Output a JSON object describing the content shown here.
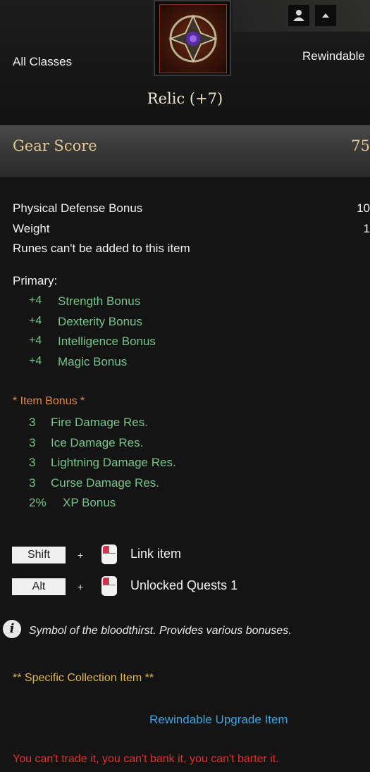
{
  "header": {
    "class_label": "All Classes",
    "rewindable_label": "Rewindable",
    "item_title": "Relic (+7)"
  },
  "gear": {
    "label": "Gear Score",
    "value": "75"
  },
  "stats": [
    {
      "label": "Physical Defense Bonus",
      "value": "10"
    },
    {
      "label": "Weight",
      "value": "1"
    },
    {
      "label": "Runes can't be added to this item",
      "value": ""
    }
  ],
  "primary": {
    "heading": "Primary:",
    "items": [
      {
        "value": "+4",
        "name": "Strength Bonus"
      },
      {
        "value": "+4",
        "name": "Dexterity Bonus"
      },
      {
        "value": "+4",
        "name": "Intelligence Bonus"
      },
      {
        "value": "+4",
        "name": "Magic Bonus"
      }
    ]
  },
  "item_bonus": {
    "heading": "* Item Bonus *",
    "items": [
      {
        "value": "3",
        "name": "Fire Damage Res."
      },
      {
        "value": "3",
        "name": "Ice Damage Res."
      },
      {
        "value": "3",
        "name": "Lightning Damage Res."
      },
      {
        "value": "3",
        "name": "Curse Damage Res."
      },
      {
        "value": "2%",
        "name": "XP Bonus"
      }
    ]
  },
  "actions": [
    {
      "key": "Shift",
      "plus": "+",
      "label": "Link item"
    },
    {
      "key": "Alt",
      "plus": "+",
      "label": "Unlocked Quests 1"
    }
  ],
  "description": "Symbol of the bloodthirst. Provides various bonuses.",
  "collection": "** Specific Collection Item **",
  "upgrade": "Rewindable Upgrade Item",
  "restriction": "You can't trade it, you can't bank it, you can't barter it.",
  "colors": {
    "bonus_green": "#77c48a",
    "item_bonus_orange": "#e08a4a",
    "collection_gold": "#e0b84a",
    "upgrade_blue": "#3aa6e0",
    "restriction_red": "#e03030",
    "gear_gold": "#e2c78f"
  }
}
